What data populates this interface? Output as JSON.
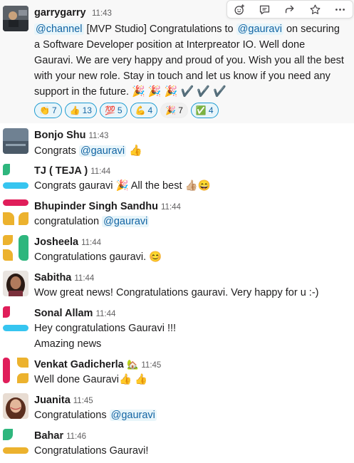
{
  "toolbar": {
    "items": [
      {
        "name": "add-reaction-icon"
      },
      {
        "name": "reply-thread-icon"
      },
      {
        "name": "share-message-icon"
      },
      {
        "name": "save-star-icon"
      },
      {
        "name": "more-actions-icon"
      }
    ]
  },
  "messages": [
    {
      "author": "garrygarry",
      "time": "11:43",
      "lines": [
        [
          "@channel",
          " [MVP Studio] Congratulations to ",
          "@gauravi",
          " on securing"
        ],
        [
          "a Software Developer position at Interpreator IO. Well done"
        ],
        [
          "Gauravi. We are very happy and proud of you. Wish you all the best"
        ],
        [
          "with your new role. Stay in touch and let us know if you need any"
        ],
        [
          "support in the future. ",
          "🎉 🎉 🎉 ✔️ ✔️ ✔️"
        ]
      ],
      "reactions": [
        {
          "emoji": "👏",
          "count": "7"
        },
        {
          "emoji": "👍",
          "count": "13"
        },
        {
          "emoji": "💯",
          "count": "5"
        },
        {
          "emoji": "💪",
          "count": "4"
        },
        {
          "emoji": "🎉",
          "count": "7"
        },
        {
          "emoji": "✅",
          "count": "4"
        }
      ]
    },
    {
      "author": "Bonjo Shu",
      "time": "11:43",
      "pre": "Congrats ",
      "mention": "@gauravi",
      "post": " 👍"
    },
    {
      "author": "TJ ( TEJA )",
      "time": "11:44",
      "text": "Congrats gauravi 🎉 All the best 👍🏼😄"
    },
    {
      "author": "Bhupinder Singh Sandhu",
      "time": "11:44",
      "pre": "congratulation ",
      "mention": "@gauravi",
      "post": ""
    },
    {
      "author": "Josheela",
      "time": "11:44",
      "text": "Congratulations gauravi. 😊"
    },
    {
      "author": "Sabitha",
      "time": "11:44",
      "text": "Wow great news! Congratulations gauravi. Very happy for u :-)"
    },
    {
      "author": "Sonal Allam",
      "time": "11:44",
      "text": "Hey congratulations Gauravi !!!",
      "text2": "Amazing news"
    },
    {
      "author": "Venkat Gadicherla",
      "badge": "🏡",
      "time": "11:45",
      "text": "Well done Gauravi👍 👍"
    },
    {
      "author": "Juanita",
      "time": "11:45",
      "pre": "Congratulations ",
      "mention": "@gauravi",
      "post": ""
    },
    {
      "author": "Bahar",
      "time": "11:46",
      "text": "Congratulations Gauravi!"
    }
  ],
  "colors": {
    "green": "#2eb67d",
    "blue": "#36c5f0",
    "red": "#e01e5a",
    "yellow": "#ecb22e",
    "mention": "#1264a3"
  }
}
